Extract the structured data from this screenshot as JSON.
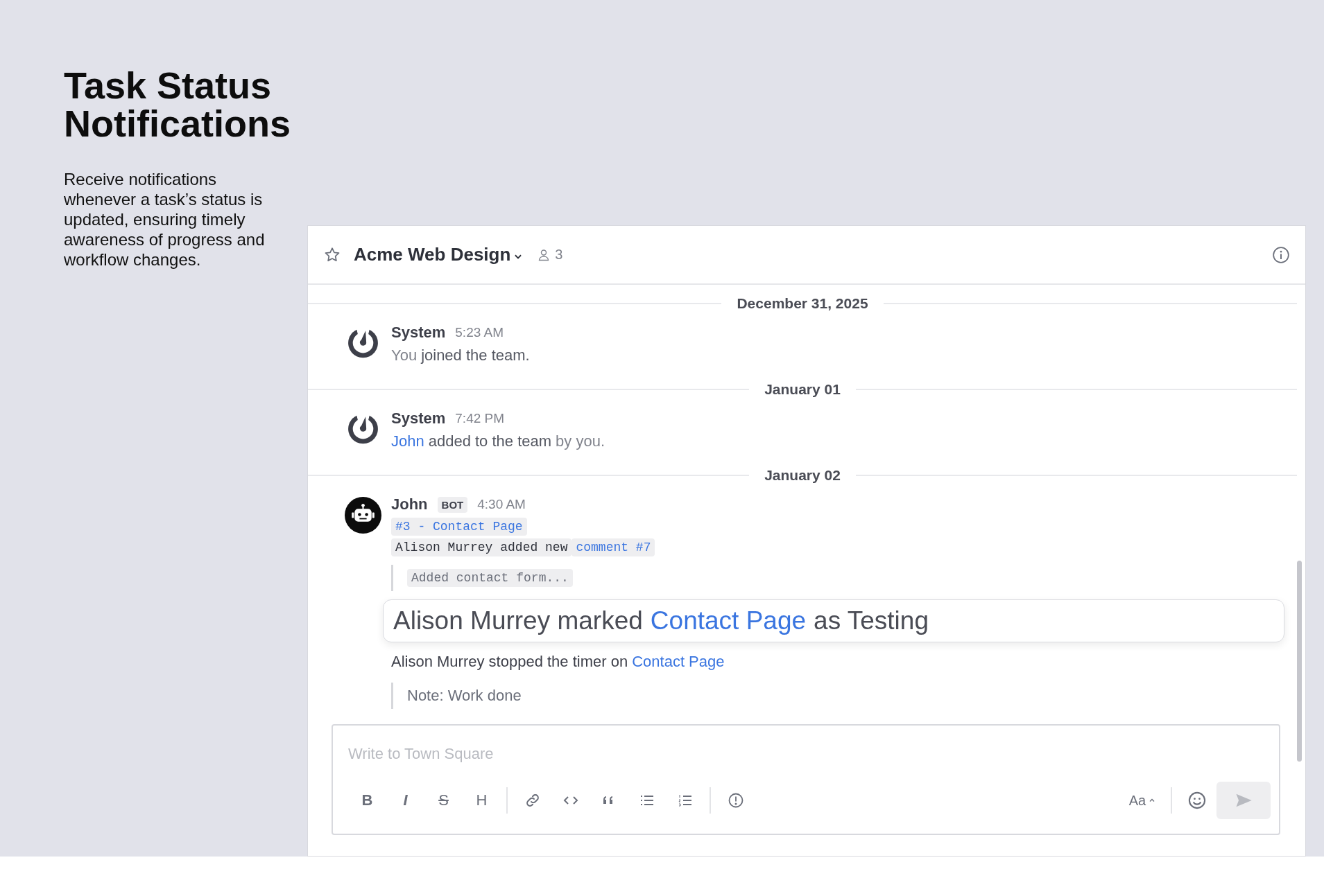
{
  "intro": {
    "title": "Task Status Notifications",
    "description": "Receive notifications whenever a task’s status is updated, ensuring timely awareness of progress and workflow changes."
  },
  "channel": {
    "name": "Acme Web Design",
    "members": "3"
  },
  "feed": [
    {
      "kind": "date",
      "label": "December 31, 2025"
    },
    {
      "kind": "message",
      "avatar": {
        "kind": "system"
      },
      "author": "System",
      "time": "5:23 AM",
      "body": [
        {
          "kind": "muted",
          "text": "You"
        },
        {
          "kind": "plain",
          "text": "joined the team."
        }
      ]
    },
    {
      "kind": "date",
      "label": "January 01"
    },
    {
      "kind": "message",
      "avatar": {
        "kind": "system"
      },
      "author": "System",
      "time": "7:42 PM",
      "body": [
        {
          "kind": "link",
          "text": "John"
        },
        {
          "kind": "plain",
          "text": "added to the team"
        },
        {
          "kind": "muted",
          "text": "by you."
        }
      ]
    },
    {
      "kind": "date",
      "label": "January 02"
    },
    {
      "kind": "bot",
      "avatar": {
        "kind": "bot"
      },
      "author": "John",
      "badge": "BOT",
      "time": "4:30 AM",
      "task": "#3 - Contact Page",
      "comment": {
        "text": "Alison Murrey added new",
        "link": "comment #7"
      },
      "quote": "Added contact form...",
      "highlight": {
        "before": "Alison Murrey marked",
        "link": "Contact Page",
        "after": "as Testing"
      },
      "timer": {
        "before": "Alison Murrey stopped the timer on",
        "link": "Contact Page"
      },
      "note": "Note: Work done"
    }
  ],
  "composer": {
    "placeholder": "Write to Town Square",
    "tools": [
      {
        "kind": "bold",
        "label": "B"
      },
      {
        "kind": "italic",
        "label": "I"
      },
      {
        "kind": "strike",
        "label": "S"
      },
      {
        "kind": "heading",
        "label": "H"
      },
      {
        "kind": "divider"
      },
      {
        "kind": "link"
      },
      {
        "kind": "code"
      },
      {
        "kind": "quote"
      },
      {
        "kind": "bullets"
      },
      {
        "kind": "numbers"
      },
      {
        "kind": "divider"
      },
      {
        "kind": "priority"
      }
    ],
    "format_label": "Aa"
  }
}
